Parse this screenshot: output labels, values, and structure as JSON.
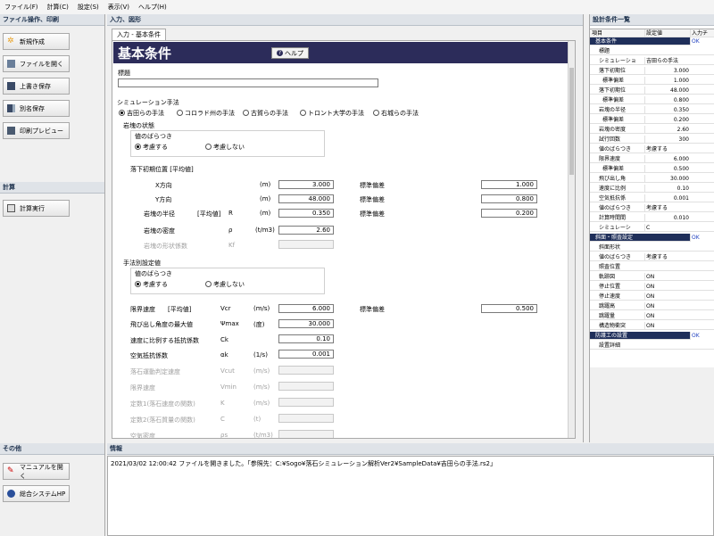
{
  "menu": [
    "ファイル(F)",
    "計算(C)",
    "設定(S)",
    "表示(V)",
    "ヘルプ(H)"
  ],
  "left": {
    "file_section": "ファイル操作、印刷",
    "file_buttons": [
      "新規作成",
      "ファイルを開く",
      "上書き保存",
      "別名保存",
      "印刷プレビュー"
    ],
    "calc_section": "計算",
    "calc_button": "計算実行",
    "other_section": "その他",
    "other_buttons": [
      "マニュアルを開く",
      "総合システムHP"
    ]
  },
  "center": {
    "panel_title": "入力、図形",
    "tab": "入力 - 基本条件",
    "form_title": "基本条件",
    "help_label": "ヘルプ",
    "title_label": "標題",
    "title_value": "",
    "sim_method_label": "シミュレーション手法",
    "sim_methods": [
      "吉田らの手法",
      "コロラド州の手法",
      "古賀らの手法",
      "トロント大学の手法",
      "右城らの手法"
    ],
    "rock_state_label": "岩塊の状態",
    "variation_label": "値のばらつき",
    "consider": "考慮する",
    "not_consider": "考慮しない",
    "drop_pos_label": "落下初期位置 [平均値]",
    "x_dir": "X方向",
    "y_dir": "Y方向",
    "unit_m": "(m)",
    "std_label": "標準偏差",
    "x_value": "3.000",
    "x_std": "1.000",
    "y_value": "48.000",
    "y_std": "0.800",
    "radius_label": "岩塊の半径",
    "avg_label": "[平均値]",
    "radius_sym": "R",
    "radius_value": "0.350",
    "radius_std": "0.200",
    "density_label": "岩塊の密度",
    "density_sym": "ρ",
    "density_unit": "(t/m3)",
    "density_value": "2.60",
    "shape_label": "岩塊の形状係数",
    "shape_sym": "Kf",
    "method_label": "手法別設定値",
    "limit_speed_label": "限界速度",
    "limit_speed_sym": "Vcr",
    "unit_ms": "(m/s)",
    "limit_speed_value": "6.000",
    "limit_speed_std": "0.500",
    "jump_angle_label": "飛び出し角度の最大値",
    "jump_angle_sym": "Ψmax",
    "unit_deg": "(度)",
    "jump_angle_value": "30.000",
    "speed_coef_label": "速度に比例する抵抗係数",
    "speed_coef_sym": "Ck",
    "speed_coef_value": "0.10",
    "air_coef_label": "空気抵抗係数",
    "air_coef_sym": "αk",
    "unit_inv_s": "(1/s)",
    "air_coef_value": "0.001",
    "disabled_rows": [
      {
        "label": "落石運動判定速度",
        "sym": "Vcut",
        "unit": "(m/s)"
      },
      {
        "label": "限界速度",
        "sym": "Vmin",
        "unit": "(m/s)"
      },
      {
        "label": "定数1(落石速度の関数)",
        "sym": "K",
        "unit": "(m/s)"
      },
      {
        "label": "定数2(落石質量の関数)",
        "sym": "C",
        "unit": "(t)"
      },
      {
        "label": "空気密度",
        "sym": "ρs",
        "unit": "(t/m3)"
      }
    ]
  },
  "right": {
    "panel_title": "設計条件一覧",
    "headers": [
      "項目",
      "設定値",
      "入力チ"
    ],
    "rows": [
      {
        "type": "cat",
        "c1": "基本条件",
        "c2": "",
        "c3": "OK"
      },
      {
        "type": "item",
        "c1": "標題",
        "c2": "",
        "c3": ""
      },
      {
        "type": "item",
        "c1": "シミュレーショ",
        "c2": "吉田らの手法",
        "c3": ""
      },
      {
        "type": "grp",
        "c1": "落下初期位",
        "c2": "3.000",
        "c3": ""
      },
      {
        "type": "sub",
        "c1": "標準偏差",
        "c2": "1.000",
        "c3": ""
      },
      {
        "type": "grp",
        "c1": "落下初期位",
        "c2": "48.000",
        "c3": ""
      },
      {
        "type": "sub",
        "c1": "標準偏差",
        "c2": "0.800",
        "c3": ""
      },
      {
        "type": "grp",
        "c1": "岩塊の半径",
        "c2": "0.350",
        "c3": ""
      },
      {
        "type": "sub",
        "c1": "標準偏差",
        "c2": "0.200",
        "c3": ""
      },
      {
        "type": "item",
        "c1": "岩塊の密度",
        "c2": "2.60",
        "c3": ""
      },
      {
        "type": "item",
        "c1": "試行回数",
        "c2": "300",
        "c3": ""
      },
      {
        "type": "item",
        "c1": "値のばらつき",
        "c2": "考慮する",
        "c3": ""
      },
      {
        "type": "grp",
        "c1": "限界速度",
        "c2": "6.000",
        "c3": ""
      },
      {
        "type": "sub",
        "c1": "標準偏差",
        "c2": "0.500",
        "c3": ""
      },
      {
        "type": "item",
        "c1": "飛び出し角",
        "c2": "30.000",
        "c3": ""
      },
      {
        "type": "item",
        "c1": "速度に比例",
        "c2": "0.10",
        "c3": ""
      },
      {
        "type": "item",
        "c1": "空気抵抗係",
        "c2": "0.001",
        "c3": ""
      },
      {
        "type": "item",
        "c1": "値のばらつき",
        "c2": "考慮する",
        "c3": ""
      },
      {
        "type": "item",
        "c1": "計算時間間",
        "c2": "0.010",
        "c3": ""
      },
      {
        "type": "item",
        "c1": "シミュレーシ",
        "c2": "C",
        "c3": ""
      },
      {
        "type": "cat",
        "c1": "斜面・照査設定",
        "c2": "",
        "c3": "OK"
      },
      {
        "type": "item",
        "c1": "斜面形状",
        "c2": "",
        "c3": ""
      },
      {
        "type": "item",
        "c1": "値のばらつき",
        "c2": "考慮する",
        "c3": ""
      },
      {
        "type": "item",
        "c1": "照査位置",
        "c2": "",
        "c3": ""
      },
      {
        "type": "item",
        "c1": "軌跡図",
        "c2": "ON",
        "c3": ""
      },
      {
        "type": "item",
        "c1": "停止位置",
        "c2": "ON",
        "c3": ""
      },
      {
        "type": "item",
        "c1": "停止速度",
        "c2": "ON",
        "c3": ""
      },
      {
        "type": "item",
        "c1": "跳躍高",
        "c2": "ON",
        "c3": ""
      },
      {
        "type": "item",
        "c1": "跳躍量",
        "c2": "ON",
        "c3": ""
      },
      {
        "type": "item",
        "c1": "構造物衝突",
        "c2": "ON",
        "c3": ""
      },
      {
        "type": "cat",
        "c1": "防護工の設置",
        "c2": "",
        "c3": "OK"
      },
      {
        "type": "item",
        "c1": "設置詳細",
        "c2": "",
        "c3": ""
      }
    ]
  },
  "bottom": {
    "panel_title": "情報",
    "log": "2021/03/02 12:00:42 ファイルを開きました。「参照先：C:¥Sogo¥落石シミュレーション解析Ver2¥SampleData¥吉田らの手法.rs2」"
  }
}
